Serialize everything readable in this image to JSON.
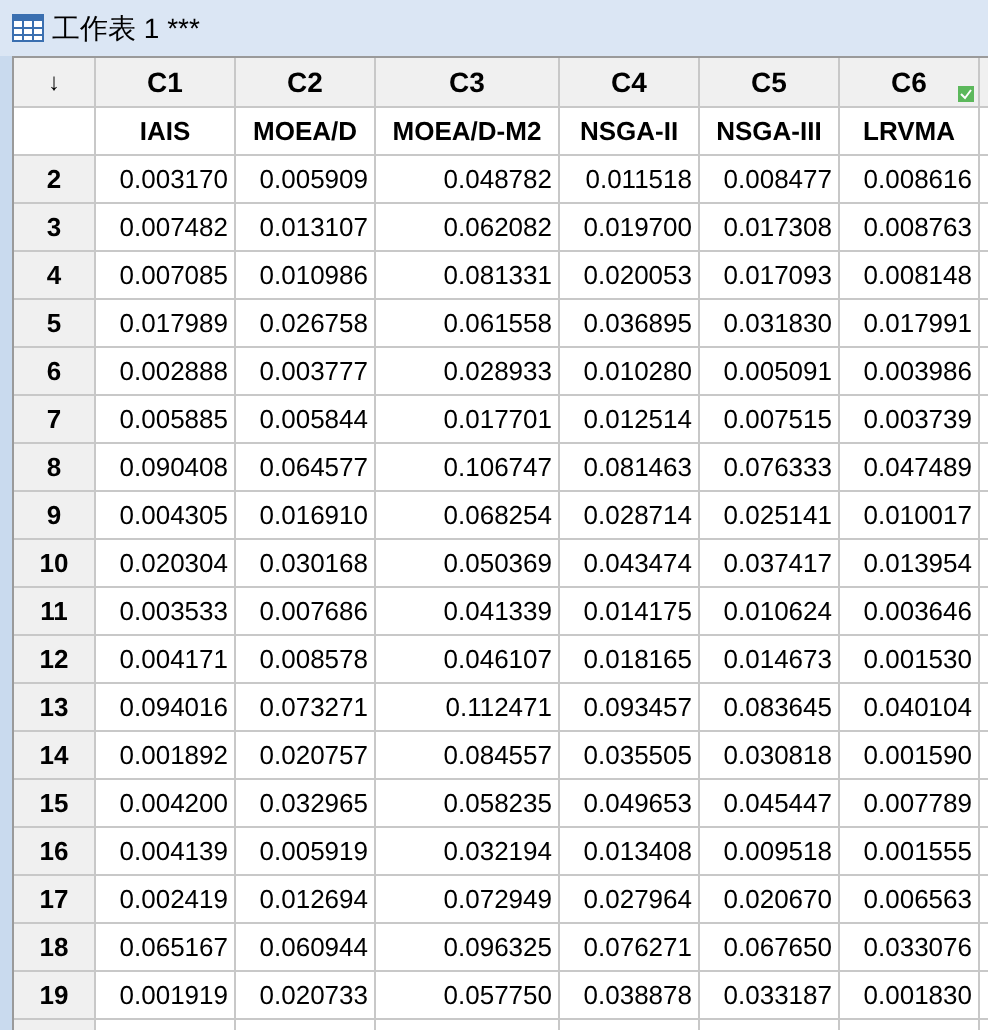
{
  "window": {
    "title": "工作表 1 ***"
  },
  "corner": "↓",
  "columns": [
    {
      "id": "C1",
      "name": "IAIS",
      "checked": false
    },
    {
      "id": "C2",
      "name": "MOEA/D",
      "checked": false
    },
    {
      "id": "C3",
      "name": "MOEA/D-M2",
      "checked": false
    },
    {
      "id": "C4",
      "name": "NSGA-II",
      "checked": false
    },
    {
      "id": "C5",
      "name": "NSGA-III",
      "checked": false
    },
    {
      "id": "C6",
      "name": "LRVMA",
      "checked": true
    }
  ],
  "rows": [
    {
      "row": "2",
      "values": [
        "0.003170",
        "0.005909",
        "0.048782",
        "0.011518",
        "0.008477",
        "0.008616"
      ]
    },
    {
      "row": "3",
      "values": [
        "0.007482",
        "0.013107",
        "0.062082",
        "0.019700",
        "0.017308",
        "0.008763"
      ]
    },
    {
      "row": "4",
      "values": [
        "0.007085",
        "0.010986",
        "0.081331",
        "0.020053",
        "0.017093",
        "0.008148"
      ]
    },
    {
      "row": "5",
      "values": [
        "0.017989",
        "0.026758",
        "0.061558",
        "0.036895",
        "0.031830",
        "0.017991"
      ]
    },
    {
      "row": "6",
      "values": [
        "0.002888",
        "0.003777",
        "0.028933",
        "0.010280",
        "0.005091",
        "0.003986"
      ]
    },
    {
      "row": "7",
      "values": [
        "0.005885",
        "0.005844",
        "0.017701",
        "0.012514",
        "0.007515",
        "0.003739"
      ]
    },
    {
      "row": "8",
      "values": [
        "0.090408",
        "0.064577",
        "0.106747",
        "0.081463",
        "0.076333",
        "0.047489"
      ]
    },
    {
      "row": "9",
      "values": [
        "0.004305",
        "0.016910",
        "0.068254",
        "0.028714",
        "0.025141",
        "0.010017"
      ]
    },
    {
      "row": "10",
      "values": [
        "0.020304",
        "0.030168",
        "0.050369",
        "0.043474",
        "0.037417",
        "0.013954"
      ]
    },
    {
      "row": "11",
      "values": [
        "0.003533",
        "0.007686",
        "0.041339",
        "0.014175",
        "0.010624",
        "0.003646"
      ]
    },
    {
      "row": "12",
      "values": [
        "0.004171",
        "0.008578",
        "0.046107",
        "0.018165",
        "0.014673",
        "0.001530"
      ]
    },
    {
      "row": "13",
      "values": [
        "0.094016",
        "0.073271",
        "0.112471",
        "0.093457",
        "0.083645",
        "0.040104"
      ]
    },
    {
      "row": "14",
      "values": [
        "0.001892",
        "0.020757",
        "0.084557",
        "0.035505",
        "0.030818",
        "0.001590"
      ]
    },
    {
      "row": "15",
      "values": [
        "0.004200",
        "0.032965",
        "0.058235",
        "0.049653",
        "0.045447",
        "0.007789"
      ]
    },
    {
      "row": "16",
      "values": [
        "0.004139",
        "0.005919",
        "0.032194",
        "0.013408",
        "0.009518",
        "0.001555"
      ]
    },
    {
      "row": "17",
      "values": [
        "0.002419",
        "0.012694",
        "0.072949",
        "0.027964",
        "0.020670",
        "0.006563"
      ]
    },
    {
      "row": "18",
      "values": [
        "0.065167",
        "0.060944",
        "0.096325",
        "0.076271",
        "0.067650",
        "0.033076"
      ]
    },
    {
      "row": "19",
      "values": [
        "0.001919",
        "0.020733",
        "0.057750",
        "0.038878",
        "0.033187",
        "0.001830"
      ]
    }
  ]
}
